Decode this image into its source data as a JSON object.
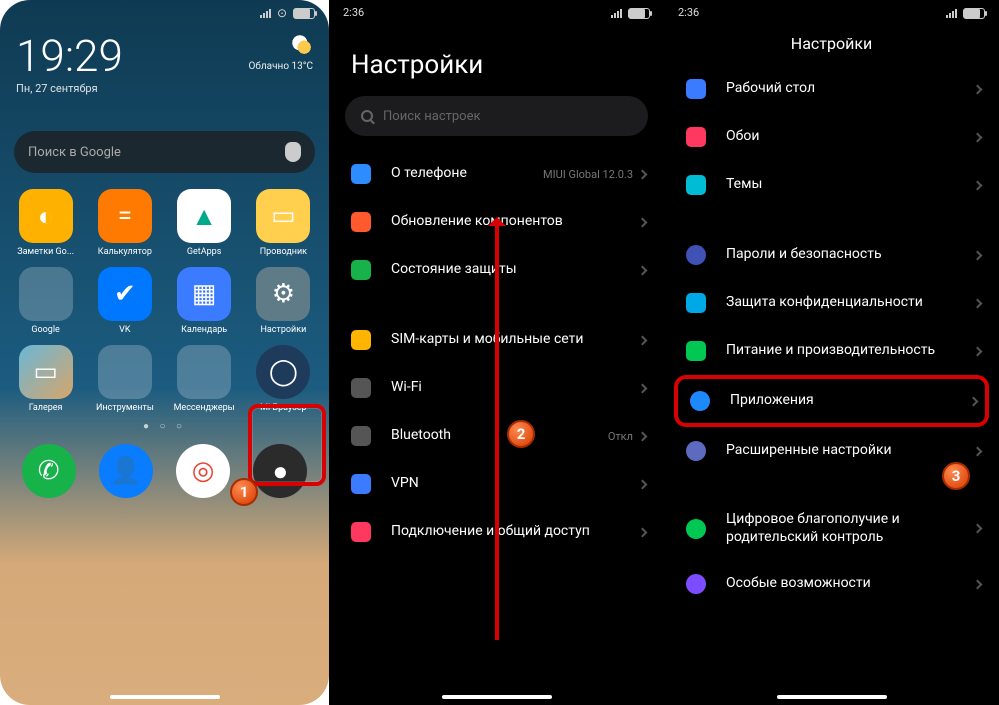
{
  "home": {
    "clock": "19:29",
    "date": "Пн, 27 сентября",
    "weather_line1": "Облачно 13°C",
    "search_placeholder": "Поиск в Google",
    "apps_r1": [
      {
        "label": "Заметки Go...",
        "bg": "#ffb100",
        "glyph": "◐"
      },
      {
        "label": "Калькулятор",
        "bg": "#ff7a00",
        "glyph": "="
      },
      {
        "label": "GetApps",
        "bg": "#ffffff",
        "glyph": "▲"
      },
      {
        "label": "Проводник",
        "bg": "#ffcf4d",
        "glyph": "▭"
      }
    ],
    "apps_r2": [
      {
        "label": "Google",
        "folder": true
      },
      {
        "label": "VK",
        "bg": "#0077ff",
        "glyph": "✔"
      },
      {
        "label": "Календарь",
        "bg": "#3a7bff",
        "glyph": "▦"
      },
      {
        "label": "Настройки",
        "bg": "#5f7b88",
        "glyph": "⚙"
      }
    ],
    "apps_r3": [
      {
        "label": "Галерея",
        "bg": "#d7a56a",
        "glyph": "▭"
      },
      {
        "label": "Инструменты",
        "folder": true
      },
      {
        "label": "Мессенджеры",
        "folder": true
      },
      {
        "label": "Mi Браузер",
        "bg": "#1f3b5b",
        "glyph": "◯"
      }
    ],
    "dock": [
      {
        "name": "phone",
        "bg": "#17b24a",
        "glyph": "✆"
      },
      {
        "name": "contacts",
        "bg": "#0a7cff",
        "glyph": "👤"
      },
      {
        "name": "chrome",
        "bg": "#fff",
        "glyph": "◎"
      },
      {
        "name": "camera",
        "bg": "#2b2b2b",
        "glyph": "●"
      }
    ]
  },
  "settings1": {
    "status_time": "2:36",
    "title": "Настройки",
    "search_placeholder": "Поиск настроек",
    "rows": [
      {
        "icon": "#2d8cff",
        "label": "О телефоне",
        "meta": "MIUI Global 12.0.3"
      },
      {
        "icon": "#ff5a2d",
        "label": "Обновление компонентов"
      },
      {
        "icon": "#17b24a",
        "label": "Состояние защиты"
      }
    ],
    "rows2": [
      {
        "icon": "#ffb400",
        "label": "SIM-карты и мобильные сети"
      },
      {
        "icon": "#888",
        "label": "Wi-Fi"
      },
      {
        "icon": "#888",
        "label": "Bluetooth",
        "meta": "Откл"
      },
      {
        "icon": "#3a7bff",
        "label": "VPN"
      },
      {
        "icon": "#ff3860",
        "label": "Подключение и общий доступ"
      }
    ]
  },
  "settings2": {
    "status_time": "2:36",
    "title": "Настройки",
    "rows": [
      {
        "icon": "#3a7bff",
        "label": "Рабочий стол"
      },
      {
        "icon": "#ff3860",
        "label": "Обои"
      },
      {
        "icon": "#00bcd4",
        "label": "Темы"
      }
    ],
    "rows2": [
      {
        "icon": "#3f51b5",
        "label": "Пароли и безопасность"
      },
      {
        "icon": "#00a8e8",
        "label": "Защита конфиденциальности"
      },
      {
        "icon": "#00c853",
        "label": "Питание и производительность"
      },
      {
        "icon": "#1e88ff",
        "label": "Приложения",
        "hl": true
      },
      {
        "icon": "#5c6bc0",
        "label": "Расширенные настройки"
      }
    ],
    "rows3": [
      {
        "icon": "#00c853",
        "label": "Цифровое благополучие и родительский контроль"
      },
      {
        "icon": "#7c4dff",
        "label": "Особые возможности"
      }
    ]
  },
  "markers": {
    "m1": "1",
    "m2": "2",
    "m3": "3"
  }
}
